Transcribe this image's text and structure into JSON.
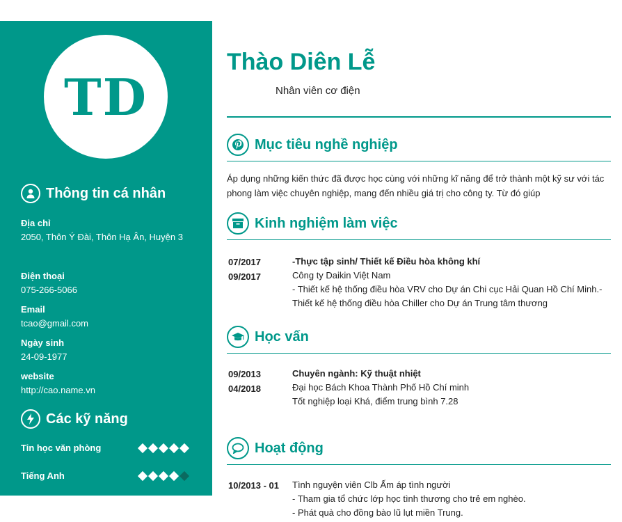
{
  "profile": {
    "initials": "TD",
    "name": "Thào Diên Lễ",
    "job_title": "Nhân viên cơ điện"
  },
  "personal": {
    "heading": "Thông tin cá nhân",
    "address_label": "Địa chỉ",
    "address_value": "2050, Thôn Ý Đài, Thôn Hạ Ân, Huyện 3",
    "phone_label": "Điện thoại",
    "phone_value": "075-266-5066",
    "email_label": "Email",
    "email_value": "tcao@gmail.com",
    "dob_label": "Ngày sinh",
    "dob_value": "24-09-1977",
    "website_label": "website",
    "website_value": "http://cao.name.vn"
  },
  "skills": {
    "heading": "Các kỹ năng",
    "items": [
      {
        "name": "Tin học văn phòng",
        "rating": 5,
        "max": 5
      },
      {
        "name": "Tiếng Anh",
        "rating": 4,
        "max": 5
      }
    ]
  },
  "objective": {
    "heading": "Mục tiêu nghề nghiệp",
    "text": "Áp dụng những kiến thức đã được học cùng với những kĩ năng để trở thành một kỹ sư với tác phong làm việc chuyên nghiệp, mang đến nhiều giá trị cho công ty. Từ đó giúp"
  },
  "experience": {
    "heading": "Kinh nghiệm làm việc",
    "items": [
      {
        "start": "07/2017",
        "end": "09/2017",
        "title": "-Thực tập sinh/ Thiết kế Điều hòa không khí",
        "company": "Công ty Daikin Việt Nam",
        "description": "- Thiết kế hệ thống điều hòa VRV cho Dự án Chi cục Hải Quan Hồ Chí Minh.- Thiết kế hệ thống điều hòa Chiller cho  Dự án Trung tâm thương"
      }
    ]
  },
  "education": {
    "heading": "Học vấn",
    "items": [
      {
        "start": "09/2013",
        "end": "04/2018",
        "major": "Chuyên ngành: Kỹ thuật nhiệt",
        "school": "Đại học Bách Khoa Thành Phố Hồ Chí minh",
        "result": "Tốt nghiệp loại Khá, điểm trung bình 7.28"
      }
    ]
  },
  "activities": {
    "heading": "Hoạt động",
    "items": [
      {
        "date": "10/2013  - 01",
        "title": "Tình nguyện viên Clb Ấm áp tình người",
        "line1": "- Tham gia tổ chức lớp học tình thương cho trẻ em nghèo.",
        "line2": "- Phát quà cho đồng bào lũ lụt miền Trung."
      }
    ]
  },
  "colors": {
    "accent": "#00988a",
    "sidebar_bg": "#00988a",
    "dot_off": "#0b6a60"
  },
  "icons": {
    "personal": "user-icon",
    "skills": "lightning-icon",
    "objective": "pinterest-icon",
    "experience": "archive-box-icon",
    "education": "graduation-cap-icon",
    "activities": "speech-bubble-icon"
  }
}
